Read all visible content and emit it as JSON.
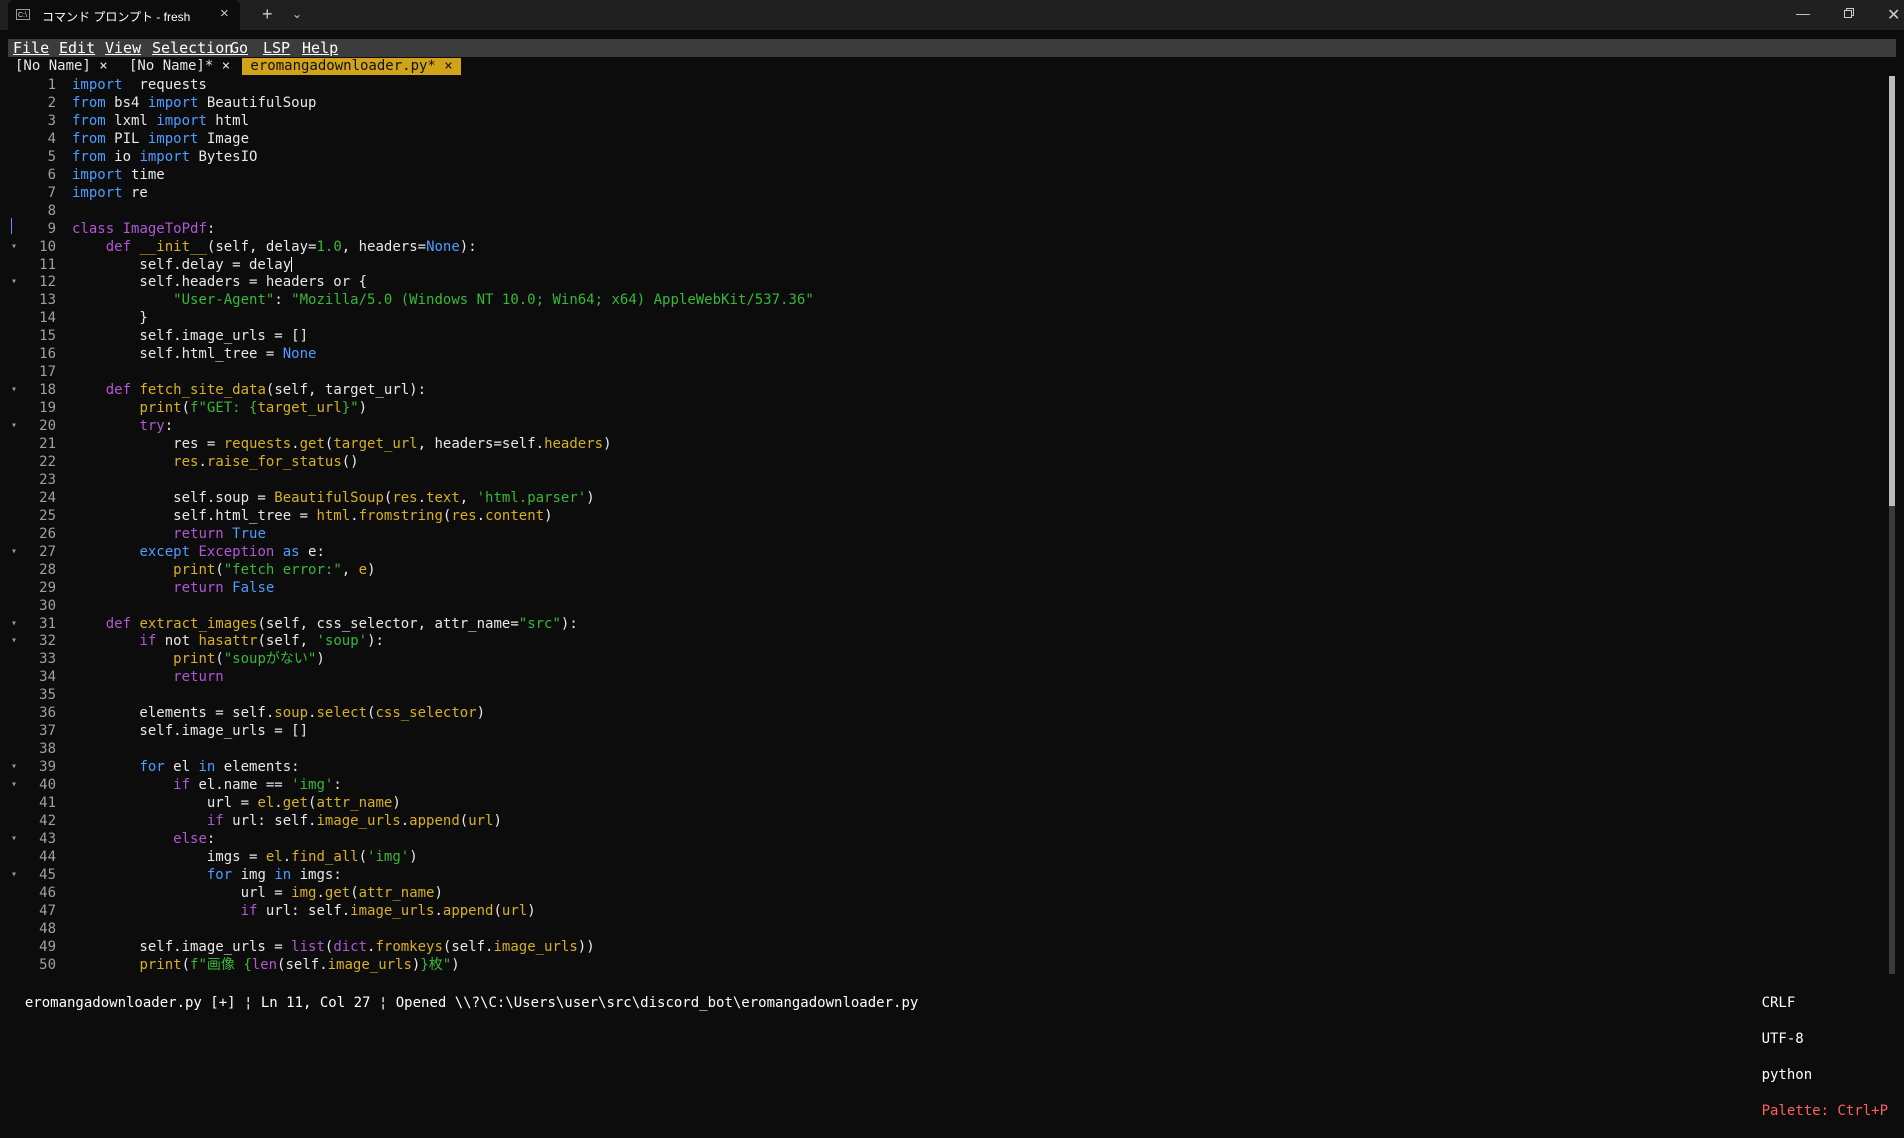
{
  "window": {
    "title": "コマンド プロンプト - fresh",
    "tab_icon": "C:\\",
    "tab_close": "×",
    "new_tab": "+",
    "dropdown": "⌄",
    "minimize": "—",
    "close": "✕"
  },
  "menu": [
    "File",
    "Edit",
    "View",
    "Selection",
    "Go",
    "LSP",
    "Help"
  ],
  "tabs": [
    {
      "label": "[No Name] ×",
      "active": false
    },
    {
      "label": "[No Name]* ×",
      "active": false
    },
    {
      "label": " eromangadownloader.py* × ",
      "active": true
    }
  ],
  "code_lines": [
    {
      "n": "1",
      "fold": "",
      "t": [
        [
          "k",
          "import"
        ],
        [
          "",
          "  requests"
        ]
      ]
    },
    {
      "n": "2",
      "fold": "",
      "t": [
        [
          "k",
          "from"
        ],
        [
          "",
          " bs4 "
        ],
        [
          "k",
          "import"
        ],
        [
          "",
          " BeautifulSoup"
        ]
      ]
    },
    {
      "n": "3",
      "fold": "",
      "t": [
        [
          "k",
          "from"
        ],
        [
          "",
          " lxml "
        ],
        [
          "k",
          "import"
        ],
        [
          "",
          " html"
        ]
      ]
    },
    {
      "n": "4",
      "fold": "",
      "t": [
        [
          "k",
          "from"
        ],
        [
          "",
          " PIL "
        ],
        [
          "k",
          "import"
        ],
        [
          "",
          " Image"
        ]
      ]
    },
    {
      "n": "5",
      "fold": "",
      "t": [
        [
          "k",
          "from"
        ],
        [
          "",
          " io "
        ],
        [
          "k",
          "import"
        ],
        [
          "",
          " BytesIO"
        ]
      ]
    },
    {
      "n": "6",
      "fold": "",
      "t": [
        [
          "k",
          "import"
        ],
        [
          "",
          " time"
        ]
      ]
    },
    {
      "n": "7",
      "fold": "",
      "t": [
        [
          "k",
          "import"
        ],
        [
          "",
          " re"
        ]
      ]
    },
    {
      "n": "8",
      "fold": "",
      "t": []
    },
    {
      "n": "9",
      "fold": "",
      "t": [
        [
          "kp",
          "class"
        ],
        [
          "",
          " "
        ],
        [
          "cls",
          "ImageToPdf"
        ],
        [
          "",
          ":"
        ]
      ]
    },
    {
      "n": "10",
      "fold": "▾",
      "t": [
        [
          "",
          "    "
        ],
        [
          "kp",
          "def"
        ],
        [
          "",
          " "
        ],
        [
          "f",
          "__init__"
        ],
        [
          "",
          "(self, delay="
        ],
        [
          "n",
          "1.0"
        ],
        [
          "",
          ", headers="
        ],
        [
          "b",
          "None"
        ],
        [
          "",
          "):"
        ]
      ]
    },
    {
      "n": "11",
      "fold": "",
      "t": [
        [
          "",
          "        self.delay = delay"
        ]
      ]
    },
    {
      "n": "12",
      "fold": "▾",
      "t": [
        [
          "",
          "        self.headers = headers or {"
        ]
      ]
    },
    {
      "n": "13",
      "fold": "",
      "t": [
        [
          "",
          "            "
        ],
        [
          "s",
          "\"User-Agent\""
        ],
        [
          "",
          ": "
        ],
        [
          "s",
          "\"Mozilla/5.0 (Windows NT 10.0; Win64; x64) AppleWebKit/537.36\""
        ]
      ]
    },
    {
      "n": "14",
      "fold": "",
      "t": [
        [
          "",
          "        }"
        ]
      ]
    },
    {
      "n": "15",
      "fold": "",
      "t": [
        [
          "",
          "        self.image_urls = []"
        ]
      ]
    },
    {
      "n": "16",
      "fold": "",
      "t": [
        [
          "",
          "        self.html_tree = "
        ],
        [
          "b",
          "None"
        ]
      ]
    },
    {
      "n": "17",
      "fold": "",
      "t": []
    },
    {
      "n": "18",
      "fold": "▾",
      "t": [
        [
          "",
          "    "
        ],
        [
          "kp",
          "def"
        ],
        [
          "",
          " "
        ],
        [
          "f",
          "fetch_site_data"
        ],
        [
          "",
          "(self, target_url):"
        ]
      ]
    },
    {
      "n": "19",
      "fold": "",
      "t": [
        [
          "",
          "        "
        ],
        [
          "f",
          "print"
        ],
        [
          "",
          "("
        ],
        [
          "s",
          "f\"GET: {"
        ],
        [
          "f",
          "target_url"
        ],
        [
          "s",
          "}\""
        ],
        [
          "",
          ")"
        ]
      ]
    },
    {
      "n": "20",
      "fold": "▾",
      "t": [
        [
          "",
          "        "
        ],
        [
          "kp",
          "try"
        ],
        [
          "",
          ":"
        ]
      ]
    },
    {
      "n": "21",
      "fold": "",
      "t": [
        [
          "",
          "            res = "
        ],
        [
          "f",
          "requests"
        ],
        [
          "",
          "."
        ],
        [
          "f",
          "get"
        ],
        [
          "",
          "("
        ],
        [
          "f",
          "target_url"
        ],
        [
          "",
          ", headers=self."
        ],
        [
          "f",
          "headers"
        ],
        [
          "",
          ")"
        ]
      ]
    },
    {
      "n": "22",
      "fold": "",
      "t": [
        [
          "",
          "            "
        ],
        [
          "f",
          "res"
        ],
        [
          "",
          "."
        ],
        [
          "f",
          "raise_for_status"
        ],
        [
          "",
          "()"
        ]
      ]
    },
    {
      "n": "23",
      "fold": "",
      "t": []
    },
    {
      "n": "24",
      "fold": "",
      "t": [
        [
          "",
          "            self.soup = "
        ],
        [
          "f",
          "BeautifulSoup"
        ],
        [
          "",
          "("
        ],
        [
          "f",
          "res"
        ],
        [
          "",
          "."
        ],
        [
          "f",
          "text"
        ],
        [
          "",
          ", "
        ],
        [
          "s",
          "'html.parser'"
        ],
        [
          "",
          ")"
        ]
      ]
    },
    {
      "n": "25",
      "fold": "",
      "t": [
        [
          "",
          "            self.html_tree = "
        ],
        [
          "f",
          "html"
        ],
        [
          "",
          "."
        ],
        [
          "f",
          "fromstring"
        ],
        [
          "",
          "("
        ],
        [
          "f",
          "res"
        ],
        [
          "",
          "."
        ],
        [
          "f",
          "content"
        ],
        [
          "",
          ")"
        ]
      ]
    },
    {
      "n": "26",
      "fold": "",
      "t": [
        [
          "",
          "            "
        ],
        [
          "kp",
          "return"
        ],
        [
          "",
          " "
        ],
        [
          "b",
          "True"
        ]
      ]
    },
    {
      "n": "27",
      "fold": "▾",
      "t": [
        [
          "",
          "        "
        ],
        [
          "k",
          "except"
        ],
        [
          "",
          " "
        ],
        [
          "cls",
          "Exception"
        ],
        [
          "",
          " "
        ],
        [
          "k",
          "as"
        ],
        [
          "",
          " e:"
        ]
      ]
    },
    {
      "n": "28",
      "fold": "",
      "t": [
        [
          "",
          "            "
        ],
        [
          "f",
          "print"
        ],
        [
          "",
          "("
        ],
        [
          "s",
          "\"fetch error:\""
        ],
        [
          "",
          ", "
        ],
        [
          "f",
          "e"
        ],
        [
          "",
          ")"
        ]
      ]
    },
    {
      "n": "29",
      "fold": "",
      "t": [
        [
          "",
          "            "
        ],
        [
          "kp",
          "return"
        ],
        [
          "",
          " "
        ],
        [
          "b",
          "False"
        ]
      ]
    },
    {
      "n": "30",
      "fold": "",
      "t": []
    },
    {
      "n": "31",
      "fold": "▾",
      "t": [
        [
          "",
          "    "
        ],
        [
          "kp",
          "def"
        ],
        [
          "",
          " "
        ],
        [
          "f",
          "extract_images"
        ],
        [
          "",
          "(self, css_selector, attr_name="
        ],
        [
          "s",
          "\"src\""
        ],
        [
          "",
          "):"
        ]
      ]
    },
    {
      "n": "32",
      "fold": "▾",
      "t": [
        [
          "",
          "        "
        ],
        [
          "kp",
          "if"
        ],
        [
          "",
          " not "
        ],
        [
          "f",
          "hasattr"
        ],
        [
          "",
          "(self, "
        ],
        [
          "s",
          "'soup'"
        ],
        [
          "",
          "):"
        ]
      ]
    },
    {
      "n": "33",
      "fold": "",
      "t": [
        [
          "",
          "            "
        ],
        [
          "f",
          "print"
        ],
        [
          "",
          "("
        ],
        [
          "s",
          "\"soupがない\""
        ],
        [
          "",
          ")"
        ]
      ]
    },
    {
      "n": "34",
      "fold": "",
      "t": [
        [
          "",
          "            "
        ],
        [
          "kp",
          "return"
        ]
      ]
    },
    {
      "n": "35",
      "fold": "",
      "t": []
    },
    {
      "n": "36",
      "fold": "",
      "t": [
        [
          "",
          "        elements = self."
        ],
        [
          "f",
          "soup"
        ],
        [
          "",
          "."
        ],
        [
          "f",
          "select"
        ],
        [
          "",
          "("
        ],
        [
          "f",
          "css_selector"
        ],
        [
          "",
          ")"
        ]
      ]
    },
    {
      "n": "37",
      "fold": "",
      "t": [
        [
          "",
          "        self.image_urls = []"
        ]
      ]
    },
    {
      "n": "38",
      "fold": "",
      "t": []
    },
    {
      "n": "39",
      "fold": "▾",
      "t": [
        [
          "",
          "        "
        ],
        [
          "k",
          "for"
        ],
        [
          "",
          " el "
        ],
        [
          "k",
          "in"
        ],
        [
          "",
          " elements:"
        ]
      ]
    },
    {
      "n": "40",
      "fold": "▾",
      "t": [
        [
          "",
          "            "
        ],
        [
          "kp",
          "if"
        ],
        [
          "",
          " el.name == "
        ],
        [
          "s",
          "'img'"
        ],
        [
          "",
          ":"
        ]
      ]
    },
    {
      "n": "41",
      "fold": "",
      "t": [
        [
          "",
          "                url = "
        ],
        [
          "f",
          "el"
        ],
        [
          "",
          "."
        ],
        [
          "f",
          "get"
        ],
        [
          "",
          "("
        ],
        [
          "f",
          "attr_name"
        ],
        [
          "",
          ")"
        ]
      ]
    },
    {
      "n": "42",
      "fold": "",
      "t": [
        [
          "",
          "                "
        ],
        [
          "kp",
          "if"
        ],
        [
          "",
          " url: self."
        ],
        [
          "f",
          "image_urls"
        ],
        [
          "",
          "."
        ],
        [
          "f",
          "append"
        ],
        [
          "",
          "("
        ],
        [
          "f",
          "url"
        ],
        [
          "",
          ")"
        ]
      ]
    },
    {
      "n": "43",
      "fold": "▾",
      "t": [
        [
          "",
          "            "
        ],
        [
          "kp",
          "else"
        ],
        [
          "",
          ":"
        ]
      ]
    },
    {
      "n": "44",
      "fold": "",
      "t": [
        [
          "",
          "                imgs = "
        ],
        [
          "f",
          "el"
        ],
        [
          "",
          "."
        ],
        [
          "f",
          "find_all"
        ],
        [
          "",
          "("
        ],
        [
          "s",
          "'img'"
        ],
        [
          "",
          ")"
        ]
      ]
    },
    {
      "n": "45",
      "fold": "▾",
      "t": [
        [
          "",
          "                "
        ],
        [
          "k",
          "for"
        ],
        [
          "",
          " img "
        ],
        [
          "k",
          "in"
        ],
        [
          "",
          " imgs:"
        ]
      ]
    },
    {
      "n": "46",
      "fold": "",
      "t": [
        [
          "",
          "                    url = "
        ],
        [
          "f",
          "img"
        ],
        [
          "",
          "."
        ],
        [
          "f",
          "get"
        ],
        [
          "",
          "("
        ],
        [
          "f",
          "attr_name"
        ],
        [
          "",
          ")"
        ]
      ]
    },
    {
      "n": "47",
      "fold": "",
      "t": [
        [
          "",
          "                    "
        ],
        [
          "kp",
          "if"
        ],
        [
          "",
          " url: self."
        ],
        [
          "f",
          "image_urls"
        ],
        [
          "",
          "."
        ],
        [
          "f",
          "append"
        ],
        [
          "",
          "("
        ],
        [
          "f",
          "url"
        ],
        [
          "",
          ")"
        ]
      ]
    },
    {
      "n": "48",
      "fold": "",
      "t": []
    },
    {
      "n": "49",
      "fold": "",
      "t": [
        [
          "",
          "        self.image_urls = "
        ],
        [
          "c",
          "list"
        ],
        [
          "",
          "("
        ],
        [
          "c",
          "dict"
        ],
        [
          "",
          "."
        ],
        [
          "f",
          "fromkeys"
        ],
        [
          "",
          "(self."
        ],
        [
          "f",
          "image_urls"
        ],
        [
          "",
          "))"
        ]
      ]
    },
    {
      "n": "50",
      "fold": "",
      "t": [
        [
          "",
          "        "
        ],
        [
          "f",
          "print"
        ],
        [
          "",
          "("
        ],
        [
          "s",
          "f\"画像 {"
        ],
        [
          "c",
          "len"
        ],
        [
          "",
          "(self."
        ],
        [
          "f",
          "image_urls"
        ],
        [
          "",
          ")"
        ],
        [
          "s",
          "}枚\""
        ],
        [
          "",
          ")"
        ]
      ]
    }
  ],
  "status": {
    "left": "eromangadownloader.py [+] ¦ Ln 11, Col 27 ¦ Opened \\\\?\\C:\\Users\\user\\src\\discord_bot\\eromangadownloader.py",
    "crlf": "CRLF",
    "encoding": "UTF-8",
    "language": "python",
    "palette": "Palette: Ctrl+P"
  }
}
